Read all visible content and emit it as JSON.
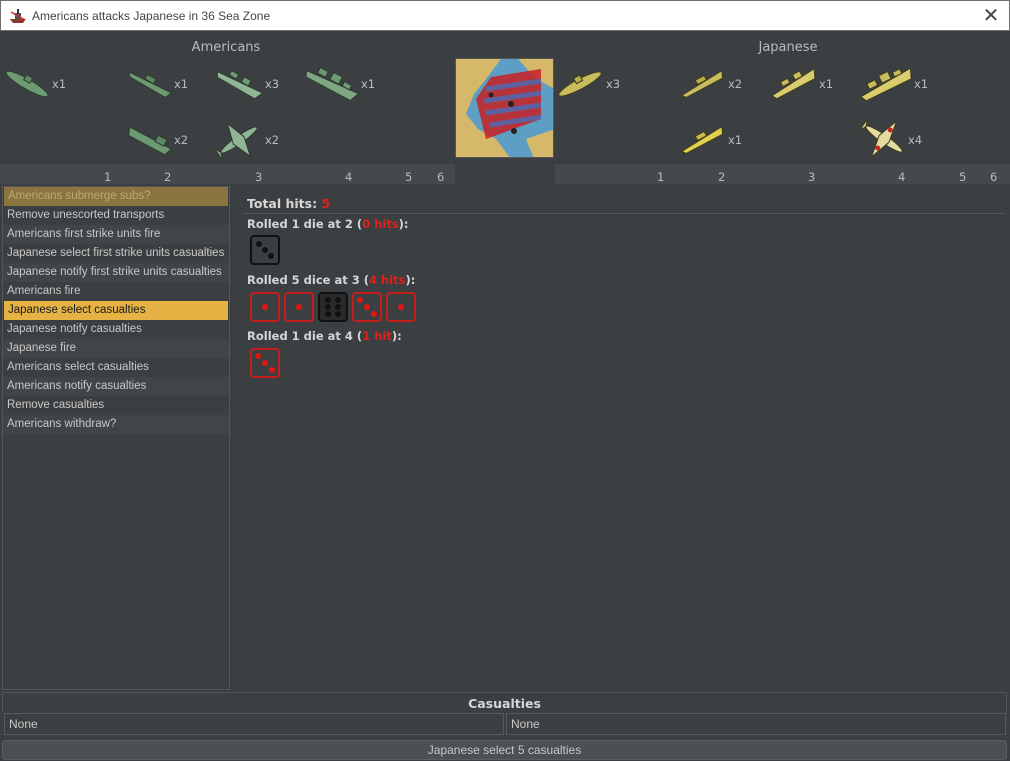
{
  "window": {
    "title": "Americans attacks Japanese in 36 Sea Zone",
    "close_glyph": "✕",
    "icon": "battle-ship-icon"
  },
  "attacker": {
    "name": "Americans",
    "color": "#6e9a73",
    "units": [
      {
        "icon": "submarine-icon",
        "count": "x1"
      },
      {
        "icon": "destroyer-icon",
        "count": "x1"
      },
      {
        "icon": "cruiser-icon",
        "count": "x3"
      },
      {
        "icon": "battleship-icon",
        "count": "x1"
      },
      {
        "icon": "transport-icon",
        "count": "x2"
      },
      {
        "icon": "fighter-icon",
        "count": "x2"
      }
    ],
    "dice_columns": [
      "1",
      "2",
      "3",
      "4",
      "5",
      "6"
    ]
  },
  "defender": {
    "name": "Japanese",
    "color": "#c9bc5c",
    "units": [
      {
        "icon": "submarine-icon",
        "count": "x3"
      },
      {
        "icon": "destroyer-icon",
        "count": "x2"
      },
      {
        "icon": "cruiser-icon",
        "count": "x1"
      },
      {
        "icon": "battleship-icon",
        "count": "x1"
      },
      {
        "icon": "destroyer-icon",
        "count": "x1"
      },
      {
        "icon": "fighter-icon",
        "count": "x4"
      }
    ],
    "dice_columns": [
      "1",
      "2",
      "3",
      "4",
      "5",
      "6"
    ]
  },
  "map_thumbnail": {
    "icon": "sea-zone-map-icon"
  },
  "steps": [
    {
      "label": "Americans submerge subs?",
      "state": "ghost"
    },
    {
      "label": "Remove unescorted transports",
      "state": "normal"
    },
    {
      "label": "Americans first strike units fire",
      "state": "normal"
    },
    {
      "label": "Japanese select first strike units casualties",
      "state": "normal"
    },
    {
      "label": "Japanese notify first strike units casualties",
      "state": "normal"
    },
    {
      "label": "Americans fire",
      "state": "normal"
    },
    {
      "label": "Japanese select casualties",
      "state": "active"
    },
    {
      "label": "Japanese notify casualties",
      "state": "normal"
    },
    {
      "label": "Japanese fire",
      "state": "normal"
    },
    {
      "label": "Americans select casualties",
      "state": "normal"
    },
    {
      "label": "Americans notify casualties",
      "state": "normal"
    },
    {
      "label": "Remove casualties",
      "state": "normal"
    },
    {
      "label": "Americans withdraw?",
      "state": "normal"
    }
  ],
  "results": {
    "total_label": "Total hits:",
    "total_value": "5",
    "rolls": [
      {
        "prefix": "Rolled 1 die at 2 (",
        "hits": "0 hits",
        "suffix": "):",
        "dice": [
          {
            "value": 3,
            "hit": false
          }
        ]
      },
      {
        "prefix": "Rolled 5 dice at 3 (",
        "hits": "4 hits",
        "suffix": "):",
        "dice": [
          {
            "value": 1,
            "hit": true
          },
          {
            "value": 1,
            "hit": true
          },
          {
            "value": 6,
            "hit": false
          },
          {
            "value": 3,
            "hit": true
          },
          {
            "value": 1,
            "hit": true
          }
        ]
      },
      {
        "prefix": "Rolled 1 die at 4 (",
        "hits": "1 hit",
        "suffix": "):",
        "dice": [
          {
            "value": 3,
            "hit": true
          }
        ]
      }
    ]
  },
  "casualties": {
    "title": "Casualties",
    "left": "None",
    "right": "None"
  },
  "action_button": "Japanese select 5 casualties"
}
